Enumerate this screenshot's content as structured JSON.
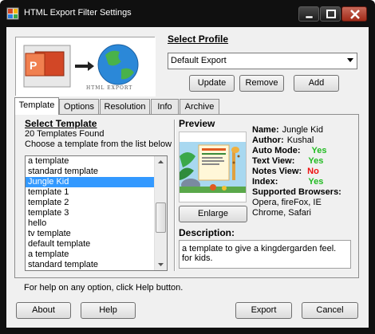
{
  "window": {
    "title": "HTML Export Filter Settings"
  },
  "banner": {
    "caption": "HTML EXPORT"
  },
  "profile": {
    "label": "Select Profile",
    "selected": "Default Export",
    "update_label": "Update",
    "remove_label": "Remove",
    "add_label": "Add"
  },
  "tabs": [
    {
      "label": "Template",
      "active": true
    },
    {
      "label": "Options",
      "active": false
    },
    {
      "label": "Resolution",
      "active": false
    },
    {
      "label": "Info",
      "active": false
    },
    {
      "label": "Archive",
      "active": false
    }
  ],
  "template": {
    "label": "Select Template",
    "found": "20 Templates Found",
    "instruction": "Choose a template from the list below",
    "items": [
      "a template",
      "standard template",
      "Jungle Kid",
      "template 1",
      "template 2",
      "template 3",
      "hello",
      "tv template",
      "default template",
      "a template",
      "standard template"
    ],
    "selected_index": 2
  },
  "preview": {
    "label": "Preview",
    "enlarge_label": "Enlarge"
  },
  "details": {
    "name_label": "Name:",
    "name": "Jungle Kid",
    "author_label": "Author:",
    "author": "Kushal",
    "auto_mode_label": "Auto Mode:",
    "auto_mode": "Yes",
    "text_view_label": "Text View:",
    "text_view": "Yes",
    "notes_view_label": "Notes View:",
    "notes_view": "No",
    "index_label": "Index:",
    "index": "Yes",
    "browsers_label": "Supported Browsers:",
    "browsers_line1": "Opera, fireFox, IE",
    "browsers_line2": "Chrome, Safari"
  },
  "description": {
    "label": "Description:",
    "text": "a template to give a kingdergarden feel. for kids."
  },
  "footer": {
    "hint": "For help on any option, click Help button.",
    "about_label": "About",
    "help_label": "Help",
    "export_label": "Export",
    "cancel_label": "Cancel"
  },
  "colors": {
    "yes": "#22bb22",
    "no": "#ee1111",
    "selection": "#3399ff"
  }
}
